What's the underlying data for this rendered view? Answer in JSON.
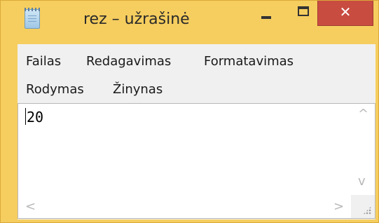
{
  "window": {
    "title": "rez – užrašinė",
    "icon": "notepad-icon",
    "controls": {
      "minimize_icon": "minimize-icon",
      "maximize_icon": "maximize-icon",
      "close_glyph": "✕",
      "close_color": "#c94c41"
    },
    "frame_color": "#f6ce5f"
  },
  "menu": {
    "items": [
      {
        "label": "Failas"
      },
      {
        "label": "Redagavimas"
      },
      {
        "label": "Formatavimas"
      },
      {
        "label": "Rodymas"
      },
      {
        "label": "Žinynas"
      }
    ]
  },
  "editor": {
    "content": "20"
  },
  "scrollbars": {
    "up_arrow": "^",
    "down_arrow": "v",
    "left_arrow": "<",
    "right_arrow": ">"
  }
}
